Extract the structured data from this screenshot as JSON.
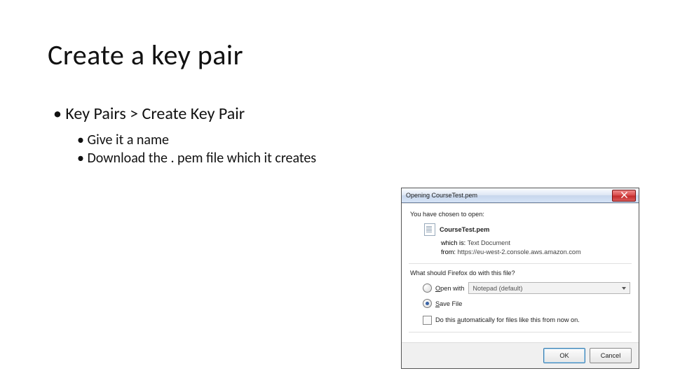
{
  "title": "Create a key pair",
  "bullets": {
    "l1": "Key Pairs > Create Key Pair",
    "l2a": "Give it a name",
    "l2b": "Download the . pem file which it creates"
  },
  "dialog": {
    "titlebar": "Opening CourseTest.pem",
    "intro": "You have chosen to open:",
    "filename": "CourseTest.pem",
    "meta": {
      "which_is_label": "which is:",
      "which_is_value": "Text Document",
      "from_label": "from:",
      "from_value": "https://eu-west-2.console.aws.amazon.com"
    },
    "question": "What should Firefox do with this file?",
    "open_with_pre": "O",
    "open_with_post": "pen with",
    "app_choice": "Notepad (default)",
    "save_pre": "S",
    "save_post": "ave File",
    "auto_pre": "Do this ",
    "auto_u": "a",
    "auto_post": "utomatically for files like this from now on.",
    "ok": "OK",
    "cancel": "Cancel"
  }
}
